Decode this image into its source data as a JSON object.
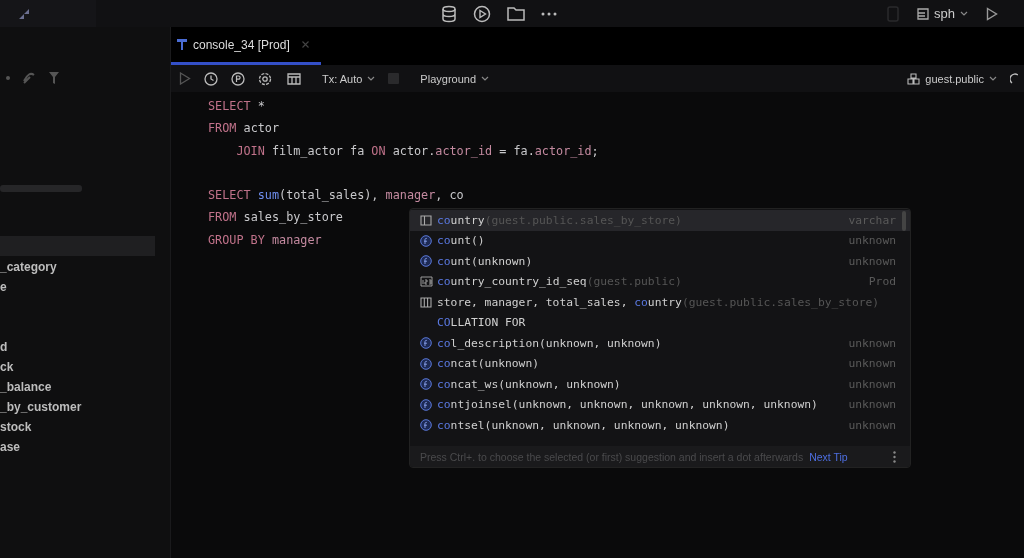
{
  "top_bar": {
    "connection": "sph"
  },
  "sidebar": {
    "items": [
      {
        "name": "_category",
        "selected": false
      },
      {
        "name": "e",
        "selected": false
      },
      {
        "name": "d",
        "selected": false
      },
      {
        "name": "ck",
        "selected": false
      },
      {
        "name": "_balance",
        "selected": false
      },
      {
        "name": "_by_customer",
        "selected": false
      },
      {
        "name": "stock",
        "selected": false
      },
      {
        "name": "ase",
        "selected": false
      }
    ]
  },
  "tabs": [
    {
      "label": "console_34 [Prod]",
      "selected": true
    }
  ],
  "toolbar": {
    "transaction": "Tx: Auto",
    "mode": "Playground",
    "schema": "guest.public"
  },
  "editor": {
    "lines": [
      {
        "kind": "code",
        "indented": false,
        "tokens": [
          {
            "kind": "keyword",
            "text": "SELECT"
          },
          {
            "kind": "plain",
            "text": " *"
          }
        ]
      },
      {
        "kind": "code",
        "indented": false,
        "tokens": [
          {
            "kind": "keyword",
            "text": "FROM"
          },
          {
            "kind": "plain",
            "text": " actor"
          }
        ]
      },
      {
        "kind": "code",
        "indented": true,
        "tokens": [
          {
            "kind": "keyword",
            "text": "JOIN"
          },
          {
            "kind": "plain",
            "text": " film_actor fa "
          },
          {
            "kind": "keyword",
            "text": "ON"
          },
          {
            "kind": "plain",
            "text": " actor."
          },
          {
            "kind": "field",
            "text": "actor_id"
          },
          {
            "kind": "plain",
            "text": " = fa."
          },
          {
            "kind": "field",
            "text": "actor_id"
          },
          {
            "kind": "plain",
            "text": ";"
          }
        ]
      },
      {
        "kind": "blank"
      },
      {
        "kind": "code",
        "indented": false,
        "tokens": [
          {
            "kind": "keyword",
            "text": "SELECT "
          },
          {
            "kind": "func",
            "text": "sum"
          },
          {
            "kind": "plain",
            "text": "(total_sales), "
          },
          {
            "kind": "field",
            "text": "manager"
          },
          {
            "kind": "plain",
            "text": ", co"
          }
        ]
      },
      {
        "kind": "code",
        "indented": false,
        "tokens": [
          {
            "kind": "keyword",
            "text": "FROM"
          },
          {
            "kind": "plain",
            "text": " sales_by_store"
          }
        ]
      },
      {
        "kind": "code",
        "indented": false,
        "tokens": [
          {
            "kind": "keyword",
            "text": "GROUP BY "
          },
          {
            "kind": "field",
            "text": "manager"
          }
        ]
      }
    ]
  },
  "completion": {
    "items": [
      {
        "kind": "column",
        "match": "co",
        "text": "untry",
        "hint": "(guest.public.sales_by_store)",
        "type": "varchar",
        "selected": true
      },
      {
        "kind": "function",
        "match": "co",
        "text": "unt()",
        "type": "unknown",
        "selected": false
      },
      {
        "kind": "function",
        "match": "co",
        "text": "unt(unknown)",
        "type": "unknown",
        "selected": false
      },
      {
        "kind": "sequence",
        "match": "co",
        "text": "untry_country_id_seq",
        "hint": "(guest.public)",
        "type": "Prod",
        "selected": false
      },
      {
        "kind": "table",
        "before": "store, manager, total_sales, ",
        "match": "co",
        "text": "untry",
        "hint": "(guest.public.sales_by_store)",
        "selected": false
      },
      {
        "kind": "keyword",
        "match": "CO",
        "text": "LLATION FOR",
        "selected": false
      },
      {
        "kind": "function",
        "match": "co",
        "text": "l_description(unknown, unknown)",
        "type": "unknown",
        "selected": false
      },
      {
        "kind": "function",
        "match": "co",
        "text": "ncat(unknown)",
        "type": "unknown",
        "selected": false
      },
      {
        "kind": "function",
        "match": "co",
        "text": "ncat_ws(unknown, unknown)",
        "type": "unknown",
        "selected": false
      },
      {
        "kind": "function",
        "match": "co",
        "text": "ntjoinsel(unknown, unknown, unknown, unknown, unknown)",
        "type": "unknown",
        "selected": false
      },
      {
        "kind": "function",
        "match": "co",
        "text": "ntsel(unknown, unknown, unknown, unknown)",
        "type": "unknown",
        "selected": false
      }
    ],
    "footer": "Press Ctrl+. to choose the selected (or first) suggestion and insert a dot afterwards",
    "tip_link": "Next Tip"
  }
}
